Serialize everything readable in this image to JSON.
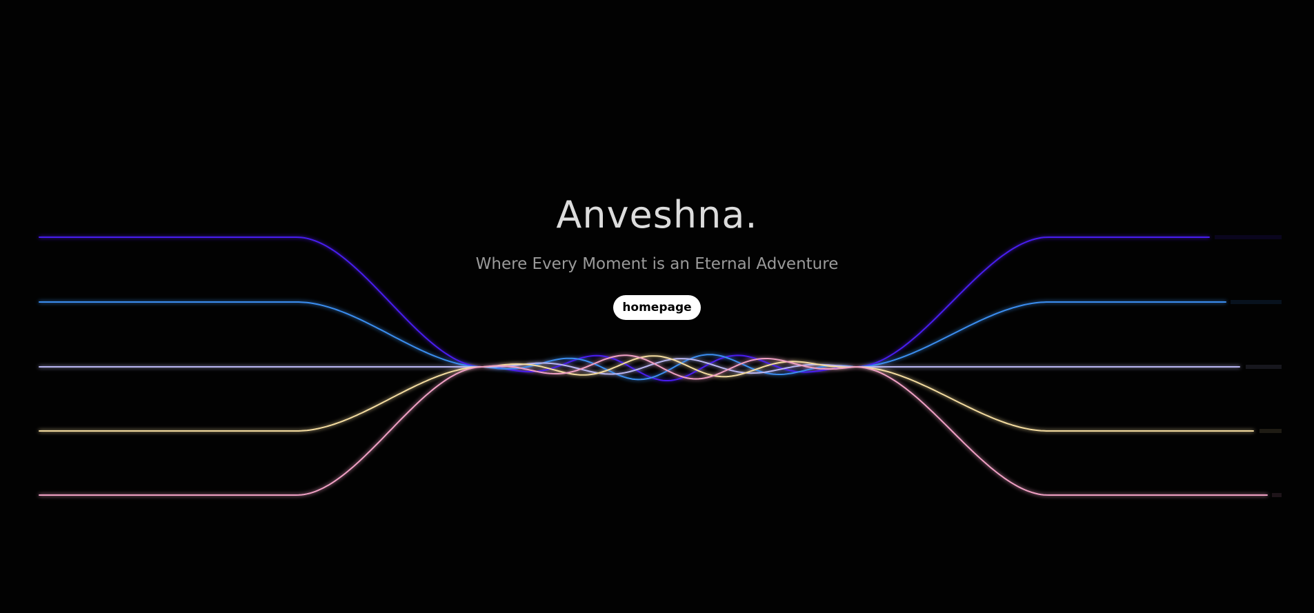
{
  "hero": {
    "title": "Anveshna.",
    "subtitle": "Where Every Moment is an Eternal Adventure",
    "button_label": "homepage"
  },
  "lines": [
    {
      "name": "violet-line",
      "color": "#4a1df0"
    },
    {
      "name": "blue-line",
      "color": "#3a8ef0"
    },
    {
      "name": "lavender-line",
      "color": "#b9b6f2"
    },
    {
      "name": "cream-line",
      "color": "#f4dca0"
    },
    {
      "name": "pink-line",
      "color": "#f0a0c4"
    }
  ]
}
